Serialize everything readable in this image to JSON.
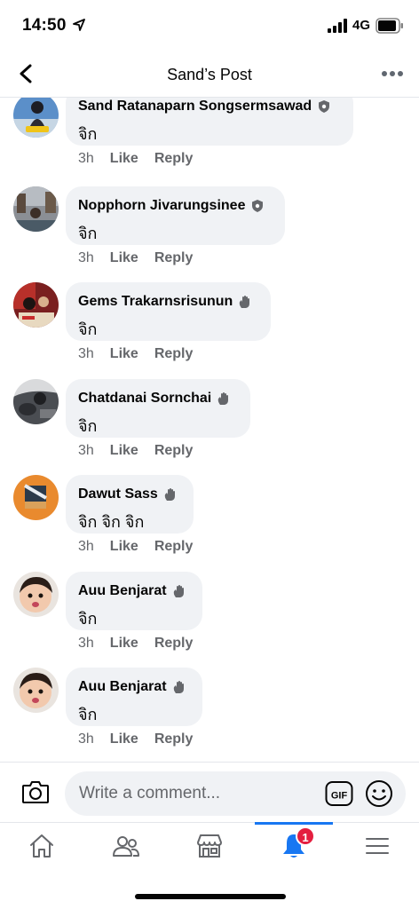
{
  "status_bar": {
    "time": "14:50",
    "network": "4G"
  },
  "header": {
    "title": "Sand’s Post"
  },
  "comments": [
    {
      "author": "Sand Ratanaparn Songsermsawad",
      "badge": "shield-icon",
      "text": "จิก",
      "time": "3h",
      "like": "Like",
      "reply": "Reply"
    },
    {
      "author": "Nopphorn Jivarungsinee",
      "badge": "shield-icon",
      "text": "จิก",
      "time": "3h",
      "like": "Like",
      "reply": "Reply"
    },
    {
      "author": "Gems Trakarnsrisunun",
      "badge": "wave-icon",
      "text": "จิก",
      "time": "3h",
      "like": "Like",
      "reply": "Reply"
    },
    {
      "author": "Chatdanai Sornchai",
      "badge": "wave-icon",
      "text": "จิก",
      "time": "3h",
      "like": "Like",
      "reply": "Reply"
    },
    {
      "author": "Dawut Sass",
      "badge": "wave-icon",
      "text": "จิก จิก จิก",
      "time": "3h",
      "like": "Like",
      "reply": "Reply"
    },
    {
      "author": "Auu Benjarat",
      "badge": "wave-icon",
      "text": "จิก",
      "time": "3h",
      "like": "Like",
      "reply": "Reply"
    },
    {
      "author": "Auu Benjarat",
      "badge": "wave-icon",
      "text": "จิก",
      "time": "3h",
      "like": "Like",
      "reply": "Reply"
    }
  ],
  "composer": {
    "placeholder": "Write a comment...",
    "gif_label": "GIF"
  },
  "tab_bar": {
    "tabs": [
      "home",
      "friends",
      "marketplace",
      "notifications",
      "menu"
    ],
    "active": "notifications",
    "notification_count": "1"
  },
  "colors": {
    "accent": "#1877f2",
    "badge": "#e41e3f",
    "bubble": "#f0f2f5",
    "secondary_text": "#65676b"
  }
}
